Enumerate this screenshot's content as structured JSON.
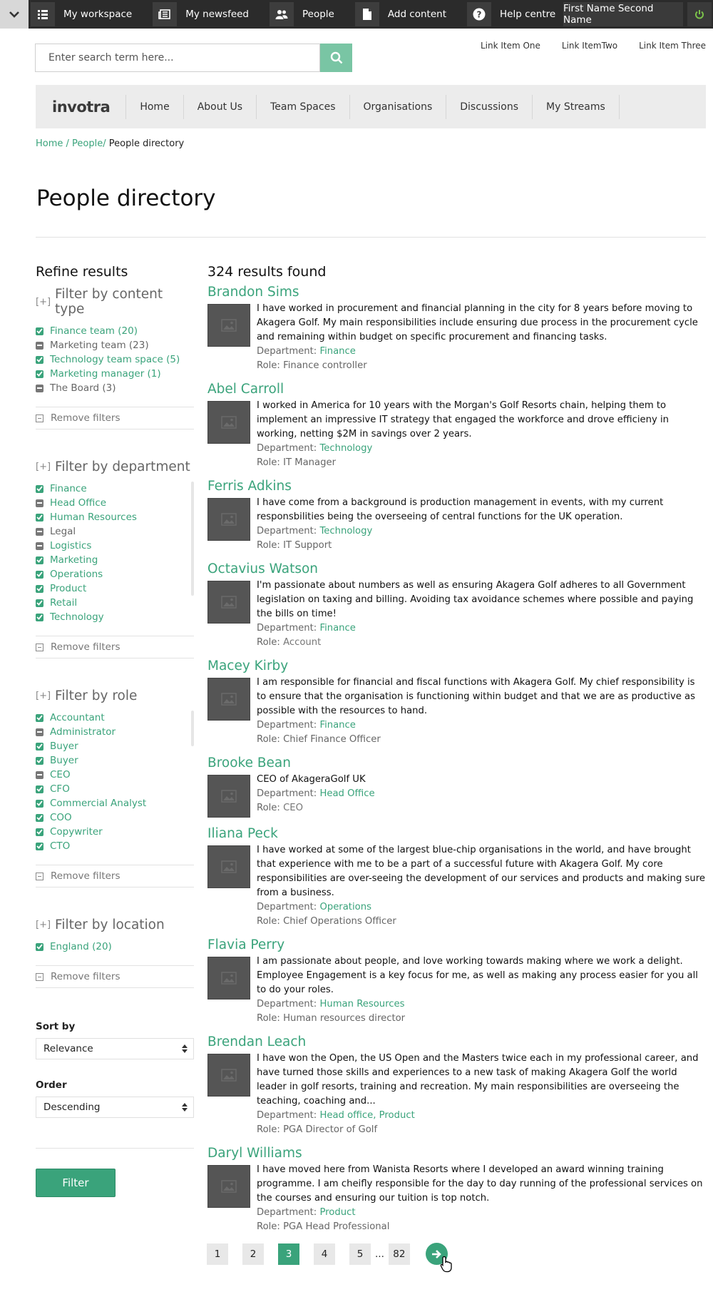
{
  "topbar": {
    "items": [
      {
        "icon": "grid-list-icon",
        "label": "My workspace"
      },
      {
        "icon": "newspaper-icon",
        "label": "My newsfeed"
      },
      {
        "icon": "people-icon",
        "label": "People"
      },
      {
        "icon": "document-icon",
        "label": "Add content"
      },
      {
        "icon": "help-icon",
        "label": "Help centre"
      }
    ],
    "user_name": "First Name Second Name"
  },
  "search": {
    "placeholder": "Enter search term here..."
  },
  "utility_links": [
    "Link Item One",
    "Link ItemTwo",
    "Link Item Three"
  ],
  "nav": {
    "logo": "invotra",
    "items": [
      "Home",
      "About Us",
      "Team Spaces",
      "Organisations",
      "Discussions",
      "My Streams"
    ]
  },
  "breadcrumb": {
    "home": "Home",
    "sep1": " / ",
    "people": "People",
    "sep2": "/ ",
    "current": "People directory"
  },
  "page_title": "People directory",
  "sidebar": {
    "refine_title": "Refine results",
    "groups": [
      {
        "title": "Filter by content type",
        "plus": "[+]",
        "items": [
          {
            "label": "Finance team (20)",
            "state": "on"
          },
          {
            "label": "Marketing team (23)",
            "state": "off"
          },
          {
            "label": "Technology team space (5)",
            "state": "on"
          },
          {
            "label": "Marketing manager (1)",
            "state": "on"
          },
          {
            "label": "The Board (3)",
            "state": "off"
          }
        ],
        "remove": "Remove filters"
      },
      {
        "title": "Filter by department",
        "plus": "[+]",
        "items": [
          {
            "label": "Finance",
            "state": "on"
          },
          {
            "label": "Head Office",
            "state": "off-green"
          },
          {
            "label": "Human Resources",
            "state": "on"
          },
          {
            "label": "Legal",
            "state": "off"
          },
          {
            "label": "Logistics",
            "state": "off-green"
          },
          {
            "label": "Marketing",
            "state": "on"
          },
          {
            "label": "Operations",
            "state": "on"
          },
          {
            "label": "Product",
            "state": "on"
          },
          {
            "label": "Retail",
            "state": "on"
          },
          {
            "label": "Technology",
            "state": "on"
          }
        ],
        "remove": "Remove filters"
      },
      {
        "title": "Filter by role",
        "plus": "[+]",
        "items": [
          {
            "label": "Accountant",
            "state": "on"
          },
          {
            "label": "Administrator",
            "state": "off-green"
          },
          {
            "label": "Buyer",
            "state": "on"
          },
          {
            "label": "Buyer",
            "state": "on"
          },
          {
            "label": "CEO",
            "state": "off-green"
          },
          {
            "label": "CFO",
            "state": "on"
          },
          {
            "label": "Commercial Analyst",
            "state": "on"
          },
          {
            "label": "COO",
            "state": "on"
          },
          {
            "label": "Copywriter",
            "state": "on"
          },
          {
            "label": "CTO",
            "state": "on"
          }
        ],
        "remove": "Remove filters"
      },
      {
        "title": "Filter by location",
        "plus": "[+]",
        "items": [
          {
            "label": "England (20)",
            "state": "on"
          }
        ],
        "remove": "Remove filters"
      }
    ],
    "sort_label": "Sort by",
    "sort_value": "Relevance",
    "order_label": "Order",
    "order_value": "Descending",
    "filter_button": "Filter"
  },
  "results": {
    "count": "324 results found",
    "department_label": "Department: ",
    "role_label": "Role: ",
    "people": [
      {
        "name": "Brandon Sims",
        "bio": "I have worked in procurement and financial planning in the city for 8 years before moving to Akagera Golf. My main responsibilities include ensuring due process in the procurement cycle and remaining within budget on specific procurement and financing tasks.",
        "department": "Finance",
        "role": "Finance controller",
        "role_style": "plain"
      },
      {
        "name": "Abel Carroll",
        "bio": "I worked in America for 10 years with the Morgan's Golf Resorts chain, helping them to implement an impressive IT strategy that engaged the workforce and drove efficieny in working, netting $2M in savings over 2 years.",
        "department": "Technology",
        "role": "IT Manager",
        "role_style": "plain"
      },
      {
        "name": "Ferris Adkins",
        "bio": "I have come from a background is production management in events, with my current responsbilities being the overseeing of central functions for the UK operation.",
        "department": "Technology",
        "role": "IT Support",
        "role_style": "plain"
      },
      {
        "name": "Octavius Watson",
        "bio": "I'm passionate about numbers as well as ensuring Akagera Golf adheres to all Government legislation on taxing and billing. Avoiding tax avoidance schemes where possible and paying the bills on time!",
        "department": "Finance",
        "role": "Account",
        "role_style": "grey"
      },
      {
        "name": "Macey Kirby",
        "bio": "I am responsible for financial and fiscal functions with Akagera Golf. My chief responsibility is to ensure that the organisation is functioning within budget and that we are as productive as possible with the resources to hand.",
        "department": "Finance",
        "role": "Chief Finance Officer",
        "role_style": "plain"
      },
      {
        "name": "Brooke Bean",
        "bio": "CEO of AkageraGolf UK",
        "department": "Head Office",
        "role": "CEO",
        "role_style": "grey"
      },
      {
        "name": "Iliana Peck",
        "bio": "I have worked at some of the largest blue-chip organisations in the world, and have brought that experience with me to be a part of a successful future with Akagera Golf. My core responsibilities are over-seeing the development of our services and products and making sure from a business.",
        "department": "Operations",
        "role": "Chief Operations Officer",
        "role_style": "plain"
      },
      {
        "name": "Flavia Perry",
        "bio": "I am passionate about people, and love working towards making where we work a delight. Employee Engagement is a key focus for me, as well as making any process easier for you all to do your roles.",
        "department": "Human Resources",
        "role": "Human resources director",
        "role_style": "plain"
      },
      {
        "name": "Brendan Leach",
        "bio": "I have won the Open, the US Open and the Masters twice each in my professional career, and have turned those skills and experiences to a new task of making Akagera Golf the world leader in golf resorts, training and recreation. My main responsibilities are overseeing the teaching, coaching and...",
        "department": "Head office, Product",
        "role": "PGA Director of Golf",
        "role_style": "plain"
      },
      {
        "name": "Daryl Williams",
        "bio": "I have moved here from Wanista Resorts where I developed an award winning training programme. I am cheifly responsible for the day to day running of the professional services on the courses and ensuring our tuition is top notch.",
        "department": "Product",
        "role": "PGA Head Professional",
        "role_style": "plain"
      }
    ]
  },
  "pagination": {
    "pages": [
      "1",
      "2",
      "3",
      "4",
      "5"
    ],
    "active": "3",
    "ellipsis": "...",
    "last": "82",
    "next_icon": "arrow-right-icon"
  },
  "colors": {
    "accent": "#3aa37b",
    "topbar": "#2b2b2b",
    "search_button": "#79c5a4",
    "nav_bg": "#ececec"
  }
}
